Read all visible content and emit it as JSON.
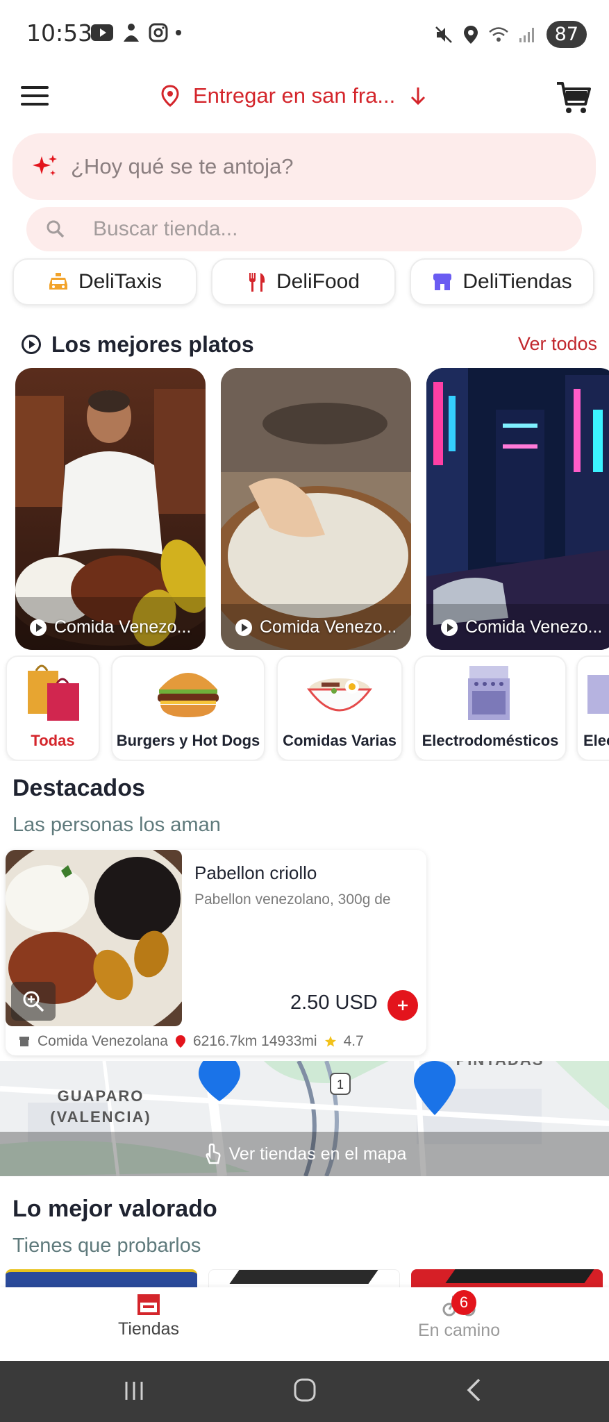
{
  "status": {
    "time": "10:53",
    "battery": "87"
  },
  "header": {
    "location": "Entregar en san fra...",
    "icons": [
      "menu-icon",
      "location-pin-icon",
      "arrow-down-icon",
      "cart-icon"
    ]
  },
  "ai_search": {
    "placeholder": "¿Hoy qué se te antoja?"
  },
  "store_search": {
    "placeholder": "Buscar tienda..."
  },
  "services": [
    {
      "label": "DeliTaxis",
      "icon": "taxi-icon",
      "color": "#f2a32a"
    },
    {
      "label": "DeliFood",
      "icon": "fork-knife-icon",
      "color": "#d4252b"
    },
    {
      "label": "DeliTiendas",
      "icon": "store-icon",
      "color": "#6a5cf2"
    }
  ],
  "best_dishes": {
    "title": "Los mejores platos",
    "see_all": "Ver todos",
    "videos": [
      {
        "caption": "Comida Venezo..."
      },
      {
        "caption": "Comida Venezo..."
      },
      {
        "caption": "Comida Venezo..."
      }
    ]
  },
  "categories": [
    {
      "label": "Todas",
      "active": true
    },
    {
      "label": "Burgers y Hot Dogs"
    },
    {
      "label": "Comidas Varias"
    },
    {
      "label": "Electrodomésticos"
    },
    {
      "label": "Elec"
    }
  ],
  "featured": {
    "title": "Destacados",
    "subtitle": "Las personas los aman",
    "product": {
      "name": "Pabellon criollo",
      "description": "Pabellon venezolano, 300g de",
      "price": "2.50 USD",
      "store": "Comida Venezolana",
      "distance": "6216.7km 14933mi",
      "rating": "4.7"
    }
  },
  "map": {
    "button": "Ver tiendas en el mapa",
    "label_1": "GUAPARO",
    "label_2": "(VALENCIA)",
    "route_number": "1",
    "top_label": "PINTADAS"
  },
  "top_rated": {
    "title": "Lo mejor valorado",
    "subtitle": "Tienes que probarlos"
  },
  "tabbar": {
    "stores": "Tiendas",
    "on_way": "En camino",
    "on_way_badge": "6",
    "active_color": "#d4252b"
  }
}
